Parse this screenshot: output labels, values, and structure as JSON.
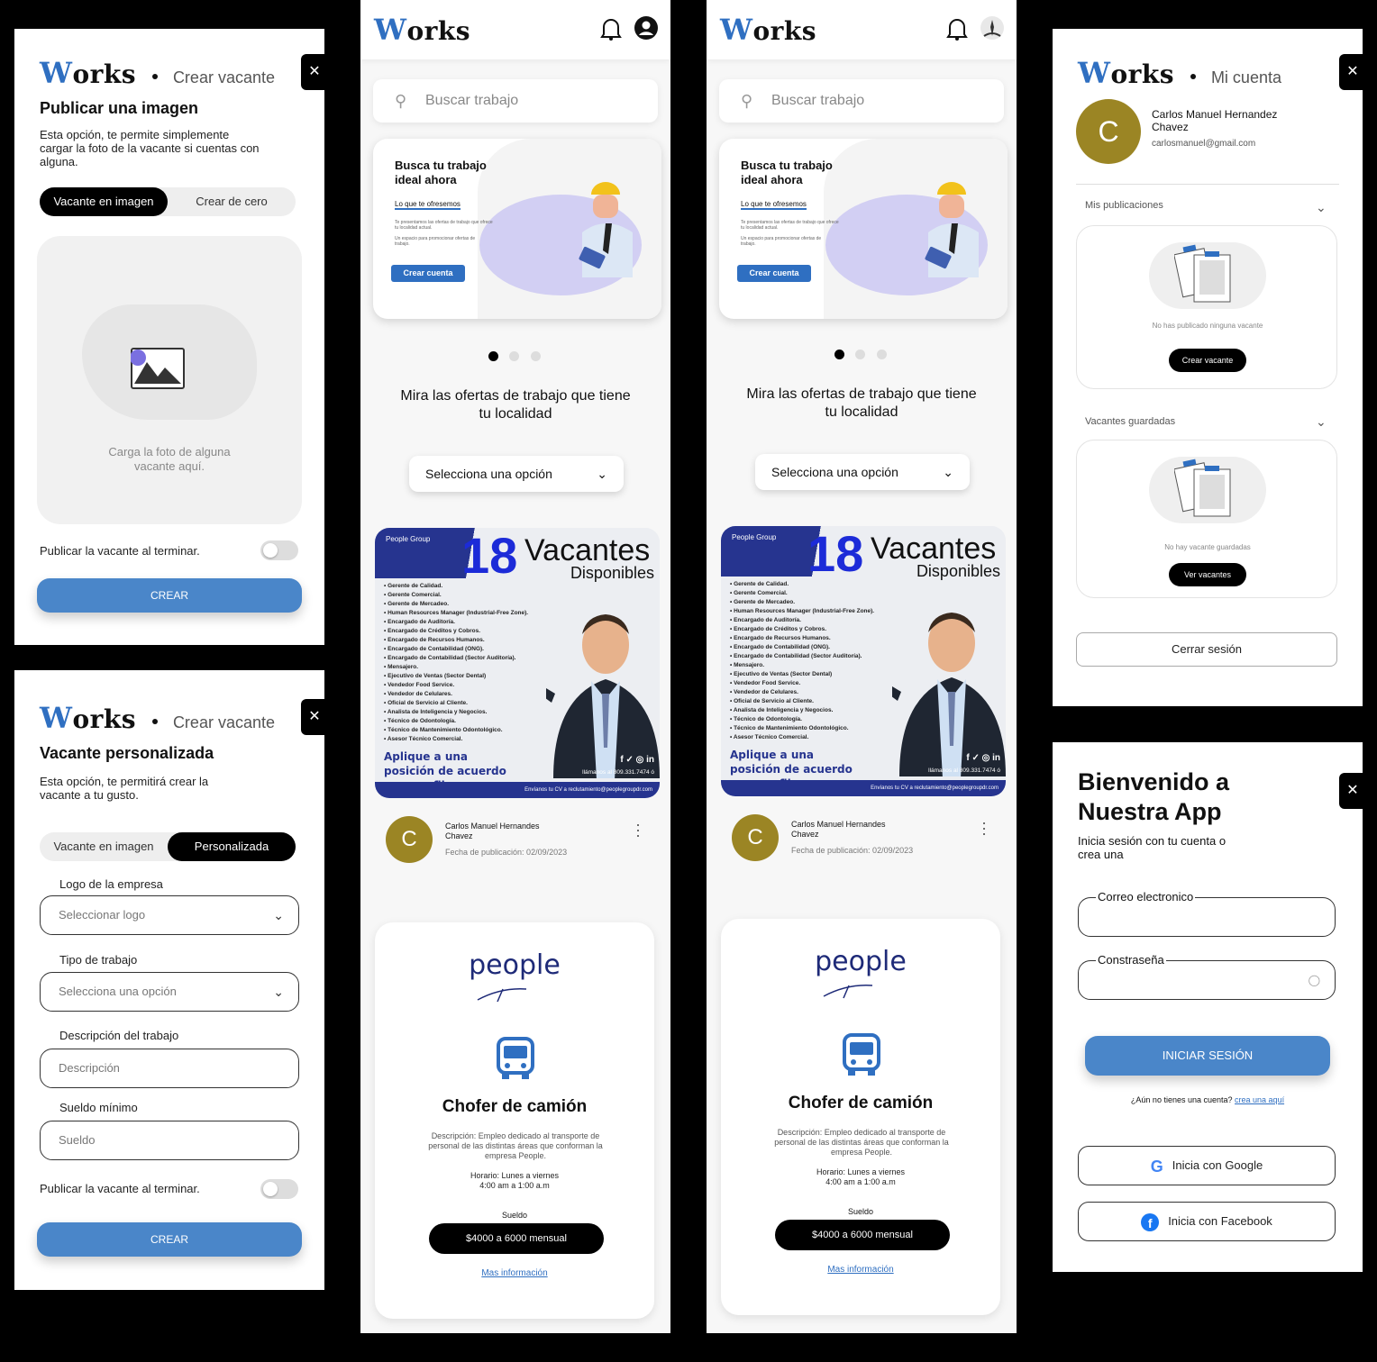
{
  "brand": "Works",
  "panel1": {
    "crumb": "Crear vacante",
    "close": "✕",
    "title": "Publicar una imagen",
    "desc": "Esta opción, te permite simplemente cargar la foto de la vacante si cuentas con alguna.",
    "seg_left": "Vacante en imagen",
    "seg_right": "Crear de cero",
    "upload_text": "Carga la foto de alguna vacante aquí.",
    "publish_label": "Publicar la vacante al terminar.",
    "create": "CREAR"
  },
  "panel2": {
    "crumb": "Crear vacante",
    "close": "✕",
    "title": "Vacante personalizada",
    "desc": "Esta opción, te permitirá crear la vacante a tu gusto.",
    "seg_left": "Vacante en imagen",
    "seg_right": "Personalizada",
    "logo_label": "Logo de la empresa",
    "logo_placeholder": "Seleccionar logo",
    "type_label": "Tipo de trabajo",
    "type_placeholder": "Selecciona una opción",
    "desc_label": "Descripción del trabajo",
    "desc_placeholder": "Descripción",
    "salary_label": "Sueldo mínimo",
    "salary_placeholder": "Sueldo",
    "publish_label": "Publicar la vacante al terminar.",
    "create": "CREAR"
  },
  "feed": {
    "search_placeholder": "Buscar trabajo",
    "hero_title": "Busca tu trabajo ideal ahora",
    "hero_sub": "Lo que te ofresemos",
    "hero_p1": "Te presentamos las ofertas de trabajo que ofrece tu localidad actual.",
    "hero_p2": "Un espacio para promocionar ofertas de trabajo.",
    "hero_btn": "Crear cuenta",
    "offers_title": "Mira las ofertas de trabajo que tiene tu localidad",
    "select": "Selecciona una opción",
    "flyer": {
      "brand": "People Group",
      "number": "18",
      "word": "Vacantes",
      "word2": "Disponibles",
      "items": [
        "Gerente de Calidad.",
        "Gerente Comercial.",
        "Gerente de Mercadeo.",
        "Human Resources Manager (Industrial-Free Zone).",
        "Encargado de Auditoría.",
        "Encargado de Créditos y Cobros.",
        "Encargado de Recursos Humanos.",
        "Encargado de Contabilidad (ONG).",
        "Encargado de Contabilidad (Sector Auditoría).",
        "Mensajero.",
        "Ejecutivo de Ventas (Sector Dental)",
        "Vendedor Food Service.",
        "Vendedor de Celulares.",
        "Oficial de Servicio al Cliente.",
        "Analista de Inteligencia y Negocios.",
        "Técnico de Odontología.",
        "Técnico de Mantenimiento Odontológico.",
        "Asesor Técnico Comercial."
      ],
      "apply": "Aplique a una posición de acuerdo a su perfil.",
      "phone": "llámanos al 809.331.7474 ó",
      "email": "Envíanos tu CV a reclutamiento@peoplegroupdr.com"
    },
    "post_author": "Carlos Manuel Hernandes Chavez",
    "post_date": "Fecha de publicación: 02/09/2023",
    "avatar_letter": "C",
    "job_brand": "people",
    "job_title": "Chofer de camión",
    "job_desc": "Descripción: Empleo dedicado al transporte de personal de las distintas áreas que conforman la empresa People.",
    "job_hours": "Horario: Lunes a viernes 4:00 am a 1:00 a.m",
    "salary_label": "Sueldo",
    "salary": "$4000 a 6000 mensual",
    "more": "Mas información"
  },
  "account": {
    "crumb": "Mi cuenta",
    "close": "✕",
    "avatar_letter": "C",
    "name": "Carlos Manuel Hernandez Chavez",
    "email": "carlosmanuel@gmail.com",
    "pubs_label": "Mis publicaciones",
    "pubs_empty": "No has publicado ninguna vacante",
    "pubs_btn": "Crear vacante",
    "saved_label": "Vacantes guardadas",
    "saved_empty": "No hay vacante guardadas",
    "saved_btn": "Ver vacantes",
    "logout": "Cerrar sesión"
  },
  "login": {
    "close": "✕",
    "title": "Bienvenido a Nuestra App",
    "sub": "Inicia sesión con tu cuenta o crea una",
    "email_label": "Correo electronico",
    "pass_label": "Constraseña",
    "login_btn": "INICIAR SESIÓN",
    "no_account": "¿Aún no tienes una cuenta?",
    "create_link": "crea una aquí",
    "google": "Inicia con Google",
    "facebook": "Inicia con Facebook"
  },
  "colors": {
    "accent": "#4a86c9",
    "avatar": "#9b8524",
    "hero_btn": "#2f6fc1"
  }
}
